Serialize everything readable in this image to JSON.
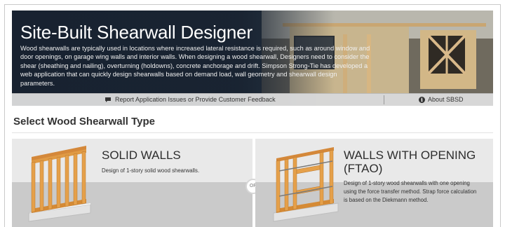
{
  "banner": {
    "title": "Site-Built Shearwall Designer",
    "description": "Wood shearwalls are typically used in locations where increased lateral resistance is required, such as around window and door openings, on garage wing walls and interior walls. When designing a wood shearwall, Designers need to consider the shear (sheathing and nailing), overturning (holdowns), concrete anchorage and drift. Simpson Strong-Tie has developed a web application that can quickly design shearwalls based on demand load, wall geometry and shearwall design parameters.",
    "report_link": "Report Application Issues or Provide Customer Feedback",
    "about_link": "About SBSD",
    "report_icon": "chat-bubble-icon",
    "about_icon": "info-icon"
  },
  "section": {
    "title": "Select Wood Shearwall Type"
  },
  "cards": [
    {
      "title": "SOLID WALLS",
      "description": "Design of 1-story solid wood shearwalls.",
      "icon": "solid-wall-illustration"
    },
    {
      "title": "WALLS WITH OPENING (FTAO)",
      "description": "Design of 1-story wood shearwalls with one opening using the force transfer method. Strap force calculation is based on the Diekmann method.",
      "icon": "wall-with-opening-illustration"
    }
  ],
  "or_label": "OR",
  "colors": {
    "banner_dark": "#1e2a3a",
    "wood": "#d9913a",
    "card_top": "#e9e9e9",
    "card_bottom": "#cacaca"
  }
}
